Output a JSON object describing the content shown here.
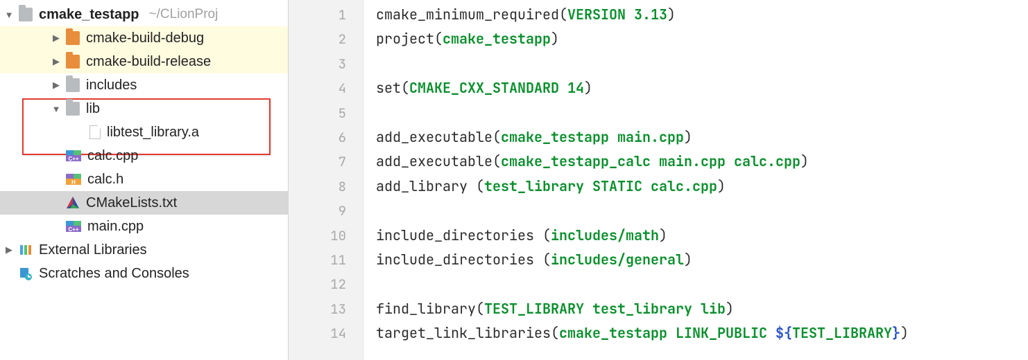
{
  "tree": {
    "root": {
      "name": "cmake_testapp",
      "hint": "~/CLionProj",
      "expanded": true
    },
    "items": [
      {
        "name": "cmake-build-debug",
        "icon": "folder-orange",
        "arrow": "right",
        "depth": 1,
        "highlight": true
      },
      {
        "name": "cmake-build-release",
        "icon": "folder-orange",
        "arrow": "right",
        "depth": 1,
        "highlight": true
      },
      {
        "name": "includes",
        "icon": "folder-grey",
        "arrow": "right",
        "depth": 1
      },
      {
        "name": "lib",
        "icon": "folder-grey",
        "arrow": "down",
        "depth": 1
      },
      {
        "name": "libtest_library.a",
        "icon": "file",
        "arrow": "none",
        "depth": 2
      },
      {
        "name": "calc.cpp",
        "icon": "cpp",
        "arrow": "none",
        "depth": 1
      },
      {
        "name": "calc.h",
        "icon": "h",
        "arrow": "none",
        "depth": 1
      },
      {
        "name": "CMakeLists.txt",
        "icon": "cmake",
        "arrow": "none",
        "depth": 1,
        "selected": true
      },
      {
        "name": "main.cpp",
        "icon": "cpp",
        "arrow": "none",
        "depth": 1
      }
    ],
    "footer": [
      {
        "name": "External Libraries",
        "icon": "extlib",
        "arrow": "right",
        "depth": 0
      },
      {
        "name": "Scratches and Consoles",
        "icon": "scratch",
        "arrow": "none",
        "depth": 0
      }
    ]
  },
  "editor": {
    "lines": [
      [
        {
          "t": "cmake_minimum_required("
        },
        {
          "t": "VERSION 3.13",
          "c": "kw"
        },
        {
          "t": ")"
        }
      ],
      [
        {
          "t": "project("
        },
        {
          "t": "cmake_testapp",
          "c": "kw"
        },
        {
          "t": ")"
        }
      ],
      [],
      [
        {
          "t": "set("
        },
        {
          "t": "CMAKE_CXX_STANDARD 14",
          "c": "kw"
        },
        {
          "t": ")"
        }
      ],
      [],
      [
        {
          "t": "add_executable("
        },
        {
          "t": "cmake_testapp main.cpp",
          "c": "kw"
        },
        {
          "t": ")"
        }
      ],
      [
        {
          "t": "add_executable("
        },
        {
          "t": "cmake_testapp_calc main.cpp calc.cpp",
          "c": "kw"
        },
        {
          "t": ")"
        }
      ],
      [
        {
          "t": "add_library ("
        },
        {
          "t": "test_library STATIC calc.cpp",
          "c": "kw"
        },
        {
          "t": ")"
        }
      ],
      [],
      [
        {
          "t": "include_directories ("
        },
        {
          "t": "includes/math",
          "c": "kw"
        },
        {
          "t": ")"
        }
      ],
      [
        {
          "t": "include_directories ("
        },
        {
          "t": "includes/general",
          "c": "kw"
        },
        {
          "t": ")"
        }
      ],
      [],
      [
        {
          "t": "find_library("
        },
        {
          "t": "TEST_LIBRARY test_library lib",
          "c": "kw"
        },
        {
          "t": ")"
        }
      ],
      [
        {
          "t": "target_link_libraries("
        },
        {
          "t": "cmake_testapp LINK_PUBLIC ",
          "c": "kw"
        },
        {
          "t": "${",
          "c": "var"
        },
        {
          "t": "TEST_LIBRARY",
          "c": "kw"
        },
        {
          "t": "}",
          "c": "var"
        },
        {
          "t": ")"
        }
      ]
    ]
  }
}
